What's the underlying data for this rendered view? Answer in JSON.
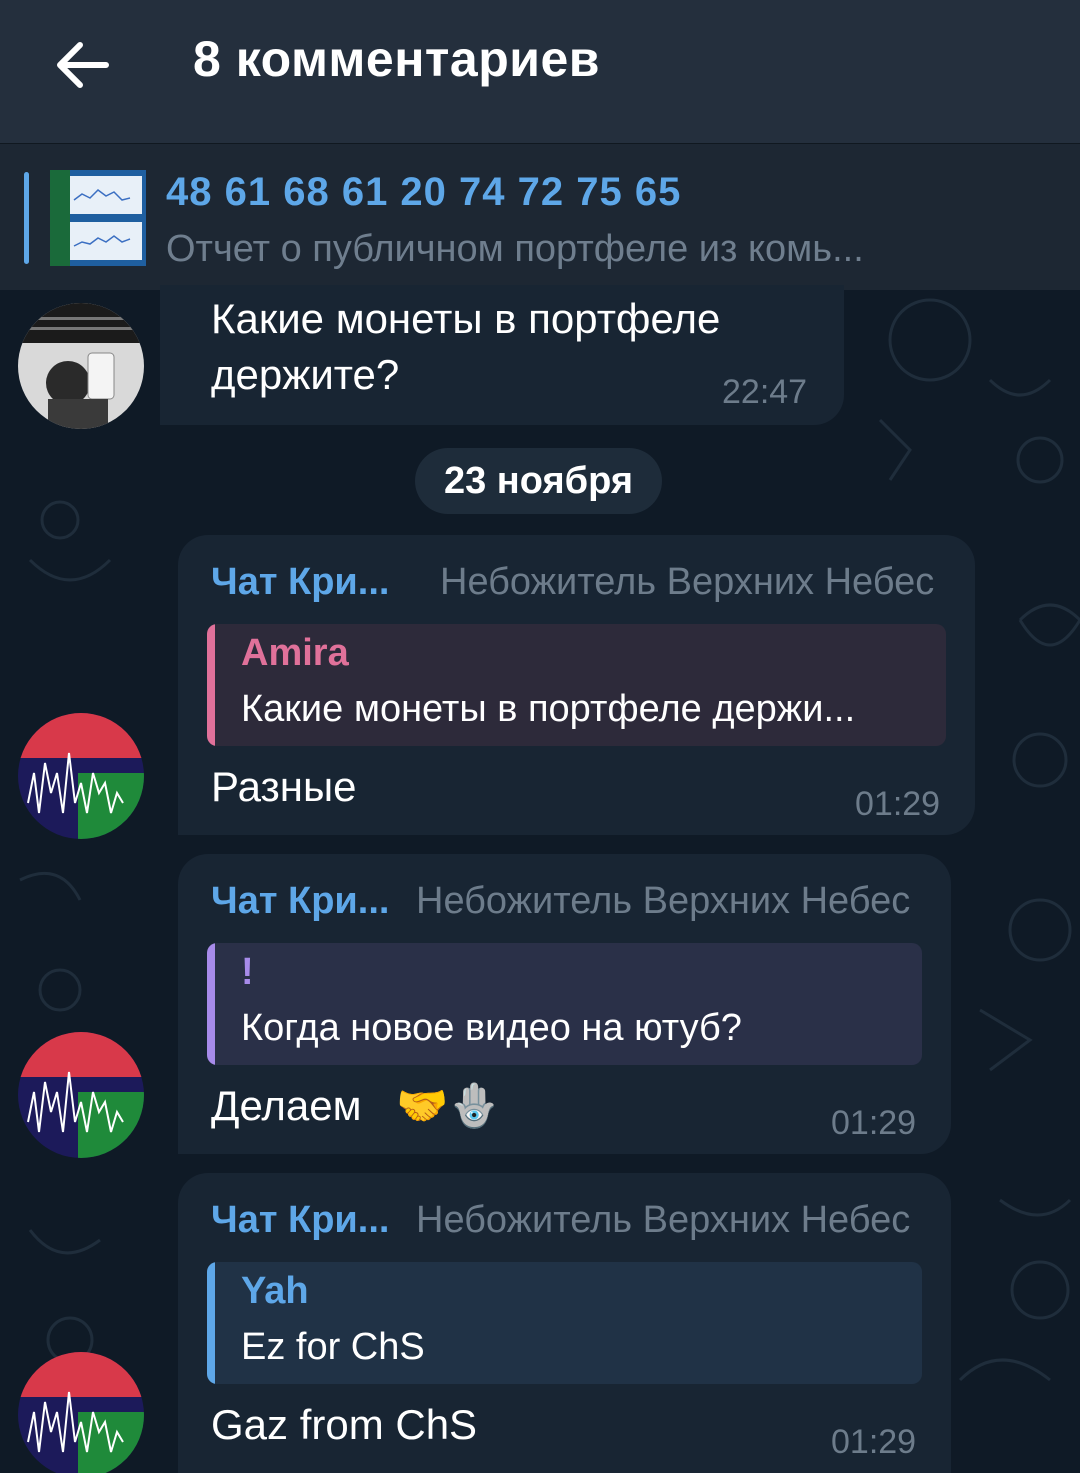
{
  "header": {
    "title": "8 комментариев"
  },
  "pinned": {
    "title": "48 61 68 61 20 74 72 75 65",
    "subtitle": "Отчет о публичном портфеле из комь..."
  },
  "messages": [
    {
      "text_line1": "Какие монеты в портфеле",
      "text_line2": "держите?",
      "time": "22:47"
    }
  ],
  "date_separator": "23 ноября",
  "replies": [
    {
      "sender": "Чат Кри...",
      "sender_title": "Небожитель Верхних Небес",
      "quote_name": "Amira",
      "quote_text": "Какие монеты в портфеле держи...",
      "text": "Разные",
      "time": "01:29"
    },
    {
      "sender": "Чат Кри...",
      "sender_title": "Небожитель Верхних Небес",
      "quote_name": "!",
      "quote_text": "Когда новое видео на ютуб?",
      "text": "Делаем",
      "emoji": "🤝🪬",
      "time": "01:29"
    },
    {
      "sender": "Чат Кри...",
      "sender_title": "Небожитель Верхних Небес",
      "quote_name": "Yah",
      "quote_text": "Ez for ChS",
      "text": "Gaz from ChS",
      "time": "01:29"
    }
  ],
  "colors": {
    "accent": "#5ea7e8",
    "quote_pink": "#e0719a",
    "quote_purple": "#a78bea",
    "quote_blue": "#5ea7e8"
  }
}
